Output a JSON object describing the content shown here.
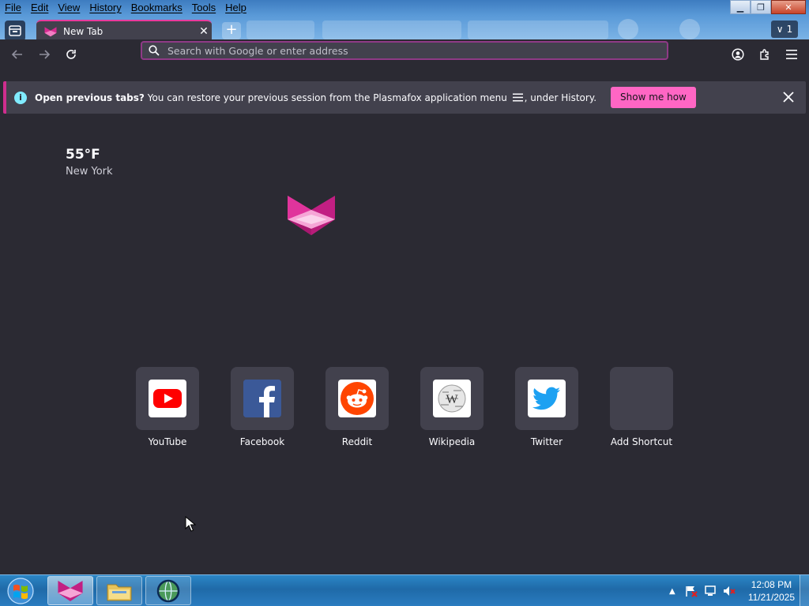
{
  "menubar": {
    "items": [
      "File",
      "Edit",
      "View",
      "History",
      "Bookmarks",
      "Tools",
      "Help"
    ]
  },
  "window_controls": {
    "minimize_icon": "minimize-icon",
    "restore_icon": "restore-icon",
    "close_icon": "close-icon"
  },
  "tabs": {
    "active_title": "New Tab",
    "overflow_count": "1"
  },
  "urlbar": {
    "placeholder": "Search with Google or enter address"
  },
  "notification": {
    "title": "Open previous tabs?",
    "message": "You can restore your previous session from the Plasmafox application menu",
    "message_suffix": ", under History.",
    "button_label": "Show me how"
  },
  "weather": {
    "temperature": "55°F",
    "city": "New York"
  },
  "shortcuts": [
    {
      "label": "YouTube",
      "icon": "youtube-icon"
    },
    {
      "label": "Facebook",
      "icon": "facebook-icon"
    },
    {
      "label": "Reddit",
      "icon": "reddit-icon"
    },
    {
      "label": "Wikipedia",
      "icon": "wikipedia-icon"
    },
    {
      "label": "Twitter",
      "icon": "twitter-icon"
    },
    {
      "label": "Add Shortcut",
      "icon": "add-shortcut"
    }
  ],
  "taskbar": {
    "time": "12:08 PM",
    "date": "11/21/2025"
  },
  "colors": {
    "accent": "#e93a9c",
    "button": "#ff66c4",
    "background": "#2b2a33",
    "surface": "#42414d"
  }
}
